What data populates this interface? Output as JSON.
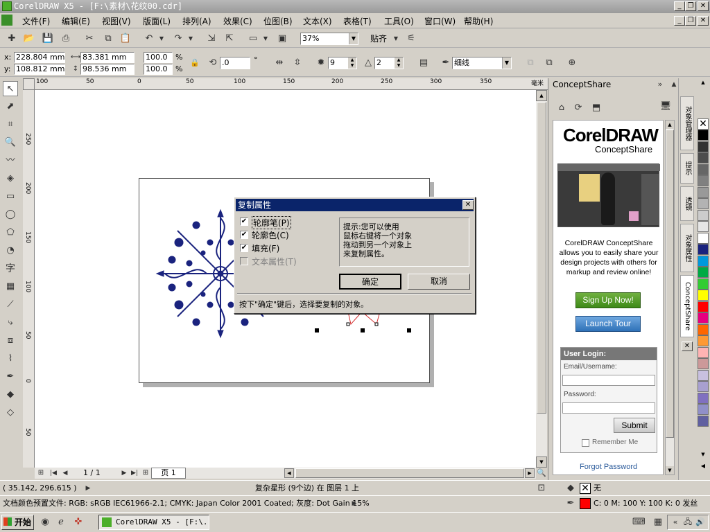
{
  "window": {
    "title": "CorelDRAW X5 - [F:\\素材\\花纹00.cdr]"
  },
  "menu": [
    "文件(F)",
    "编辑(E)",
    "视图(V)",
    "版面(L)",
    "排列(A)",
    "效果(C)",
    "位图(B)",
    "文本(X)",
    "表格(T)",
    "工具(O)",
    "窗口(W)",
    "帮助(H)"
  ],
  "toolbar": {
    "zoom": "37%",
    "snap": "贴齐"
  },
  "propbar": {
    "x": "228.804 mm",
    "y": "108.812 mm",
    "w": "83.381 mm",
    "h": "98.536 mm",
    "sx": "100.0",
    "sy": "100.0",
    "pct": "%",
    "angle": ".0",
    "deg": "°",
    "points": "9",
    "sharp": "2",
    "outline": "细线",
    "xl": "x:",
    "yl": "y:"
  },
  "ruler": {
    "h": [
      "100",
      "50",
      "0",
      "50",
      "100",
      "150",
      "200",
      "250",
      "300",
      "350"
    ],
    "unit": "毫米",
    "v": [
      "250",
      "200",
      "150",
      "100",
      "50",
      "0",
      "50"
    ]
  },
  "dialog": {
    "title": "复制属性",
    "opts": [
      "轮廓笔(P)",
      "轮廓色(C)",
      "填充(F)",
      "文本属性(T)"
    ],
    "checked": [
      true,
      true,
      true,
      false
    ],
    "hint": "提示:您可以使用\n鼠标右键将一个对象\n拖动到另一个对象上\n来复制属性。",
    "ok": "确定",
    "cancel": "取消",
    "footer": "按下\"确定\"键后，选择要复制的对象。"
  },
  "pagenav": {
    "count": "1 / 1",
    "page": "页 1"
  },
  "docker": {
    "title": "ConceptShare",
    "logo1": "CorelDRAW",
    "logo2": "ConceptShare",
    "desc": "CorelDRAW ConceptShare allows you to easily share your design projects with others for markup and review online!",
    "signup": "Sign Up Now!",
    "tour": "Launch Tour",
    "login": "User Login:",
    "email": "Email/Username:",
    "password": "Password:",
    "submit": "Submit",
    "remember": "Remember Me",
    "forgot": "Forgot Password"
  },
  "tabs": [
    "对象管理器",
    "提示",
    "透镜",
    "对象属性",
    "ConceptShare"
  ],
  "palette": [
    "#ffffff",
    "#000000",
    "#333333",
    "#4d4d4d",
    "#666666",
    "#808080",
    "#999999",
    "#b3b3b3",
    "#cccccc",
    "#e6e6e6",
    "#ffffff",
    "#1a237e",
    "#0099dd",
    "#00aa44",
    "#33cc33",
    "#ffff00",
    "#ff0000",
    "#e60080",
    "#ff6600",
    "#ff9933",
    "#ffb3b3",
    "#cc9999",
    "#c8c0e0",
    "#a8a0d0",
    "#8070c0",
    "#9090c8",
    "#6060a0"
  ],
  "status": {
    "coords": "( 35.142, 296.615 )",
    "object": "复杂星形 (9个边) 在 图层 1 上",
    "profile": "文档颜色预置文件: RGB: sRGB IEC61966-2.1; CMYK: Japan Color 2001 Coated; 灰度: Dot Gain 15%",
    "fill": "无",
    "outline": "C: 0 M: 100 Y: 100 K: 0 发丝"
  },
  "taskbar": {
    "start": "开始",
    "app": "CorelDRAW X5 - [F:\\..."
  }
}
